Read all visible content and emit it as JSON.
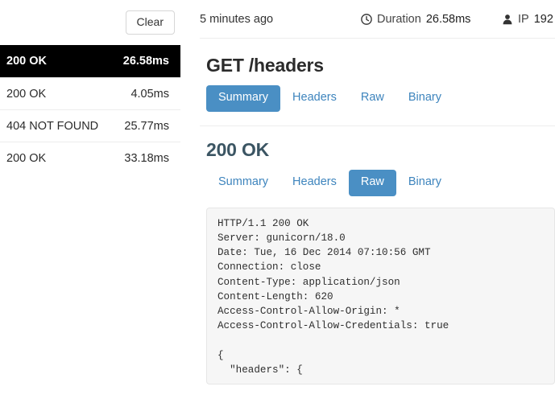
{
  "sidebar": {
    "clear_button_label": "Clear",
    "requests": [
      {
        "status": "200 OK",
        "time": "26.58ms",
        "selected": true
      },
      {
        "status": "200 OK",
        "time": "4.05ms",
        "selected": false
      },
      {
        "status": "404 NOT FOUND",
        "time": "25.77ms",
        "selected": false
      },
      {
        "status": "200 OK",
        "time": "33.18ms",
        "selected": false
      }
    ]
  },
  "meta_bar": {
    "time_ago": "5 minutes ago",
    "clock_icon": "clock-icon",
    "duration_label": "Duration",
    "duration_value": "26.58ms",
    "user_icon": "person-icon",
    "ip_label": "IP",
    "ip_value": "192"
  },
  "request": {
    "title": "GET /headers",
    "tabs": [
      {
        "label": "Summary",
        "active": true
      },
      {
        "label": "Headers",
        "active": false
      },
      {
        "label": "Raw",
        "active": false
      },
      {
        "label": "Binary",
        "active": false
      }
    ]
  },
  "response": {
    "title": "200 OK",
    "tabs": [
      {
        "label": "Summary",
        "active": false
      },
      {
        "label": "Headers",
        "active": false
      },
      {
        "label": "Raw",
        "active": true
      },
      {
        "label": "Binary",
        "active": false
      }
    ],
    "raw_body": "HTTP/1.1 200 OK\nServer: gunicorn/18.0\nDate: Tue, 16 Dec 2014 07:10:56 GMT\nConnection: close\nContent-Type: application/json\nContent-Length: 620\nAccess-Control-Allow-Origin: *\nAccess-Control-Allow-Credentials: true\n\n{\n  \"headers\": {"
  },
  "colors": {
    "accent_blue": "#4a8fc4",
    "link_blue": "#3d84bd",
    "selected_row_bg": "#000000",
    "response_title": "#3b5563",
    "code_bg": "#f6f6f6"
  }
}
